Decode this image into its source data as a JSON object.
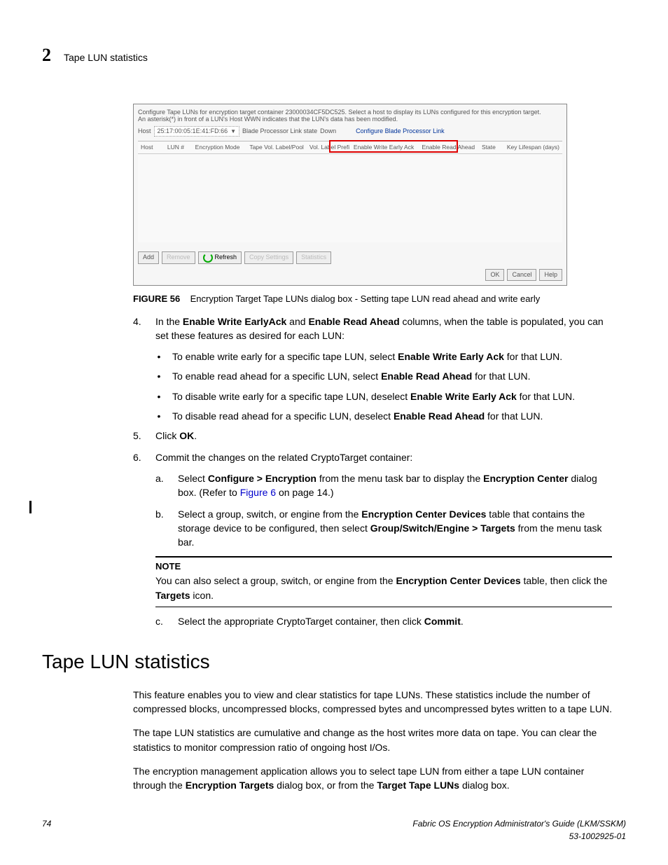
{
  "header": {
    "chapter_num": "2",
    "running_title": "Tape LUN statistics"
  },
  "figure": {
    "desc_line1": "Configure Tape LUNs for encryption target container 23000034CF5DC525. Select a host to display its LUNs configured for this encryption target.",
    "desc_line2": "An asterisk(*) in front of a LUN's Host WWN indicates that the LUN's data has been modified.",
    "host_label": "Host",
    "host_value": "25:17:00:05:1E:41:FD:66",
    "blade_state_label": "Blade Processor Link state",
    "blade_state_value": "Down",
    "configure_link": "Configure Blade Processor Link",
    "cols": {
      "c1": "Host",
      "c2": "LUN #",
      "c3": "Encryption Mode",
      "c4": "Tape Vol. Label/Pool",
      "c5": "Vol. Label Prefi",
      "c6": "Enable Write Early Ack",
      "c7": "Enable Read Ahead",
      "c8": "State",
      "c9": "Key Lifespan (days)"
    },
    "btns": {
      "add": "Add",
      "remove": "Remove",
      "refresh": "Refresh",
      "copy": "Copy Settings",
      "stats": "Statistics",
      "ok": "OK",
      "cancel": "Cancel",
      "help": "Help"
    },
    "caption_label": "FIGURE 56",
    "caption_text": "Encryption Target Tape LUNs dialog box - Setting tape LUN read ahead and write early"
  },
  "steps": {
    "s4_pre": "In the ",
    "s4_b1": "Enable Write EarlyAck",
    "s4_mid1": " and ",
    "s4_b2": "Enable Read Ahead",
    "s4_post": " columns, when the table is populated, you can set these features as desired for each LUN:",
    "b1_pre": "To enable write early for a specific tape LUN, select ",
    "b1_bold": "Enable Write Early Ack",
    "b1_post": " for that LUN.",
    "b2_pre": "To enable read ahead for a specific LUN, select ",
    "b2_bold": "Enable Read Ahead",
    "b2_post": " for that LUN.",
    "b3_pre": "To disable write early for a specific tape LUN, deselect ",
    "b3_bold": "Enable Write Early Ack",
    "b3_post": " for that LUN.",
    "b4_pre": "To disable read ahead for a specific LUN, deselect ",
    "b4_bold": "Enable Read Ahead",
    "b4_post": " for that LUN.",
    "s5_pre": "Click ",
    "s5_bold": "OK",
    "s5_post": ".",
    "s6": "Commit the changes on the related CryptoTarget container:",
    "a_pre": "Select ",
    "a_bold1": "Configure > Encryption",
    "a_mid": " from the menu task bar to display the ",
    "a_bold2": "Encryption Center",
    "a_post1": " dialog box. (Refer to ",
    "a_link": "Figure 6",
    "a_post2": " on page 14.)",
    "b_pre": "Select a group, switch, or engine from the ",
    "b_bold1": "Encryption Center Devices",
    "b_mid": " table that contains the storage device to be configured, then select ",
    "b_bold2": "Group/Switch/Engine > Targets",
    "b_post": " from the menu task bar.",
    "note_label": "NOTE",
    "note_pre": "You can also select a group, switch, or engine from the ",
    "note_bold1": "Encryption Center Devices",
    "note_mid": " table, then click the ",
    "note_bold2": "Targets",
    "note_post": " icon.",
    "c_pre": "Select the appropriate CryptoTarget container, then click ",
    "c_bold": "Commit",
    "c_post": "."
  },
  "section": {
    "heading": "Tape LUN statistics",
    "p1": "This feature enables you to view and clear statistics for tape LUNs. These statistics include the number of compressed blocks, uncompressed blocks, compressed bytes and uncompressed bytes written to a tape LUN.",
    "p2": "The tape LUN statistics are cumulative and change as the host writes more data on tape. You can clear the statistics to monitor compression ratio of ongoing host I/Os.",
    "p3_pre": "The encryption management application allows you to select tape LUN from either a tape LUN container through the ",
    "p3_b1": "Encryption Targets",
    "p3_mid": " dialog box, or from the ",
    "p3_b2": "Target Tape LUNs",
    "p3_post": " dialog box."
  },
  "footer": {
    "page": "74",
    "title": "Fabric OS Encryption Administrator's Guide  (LKM/SSKM)",
    "docnum": "53-1002925-01"
  }
}
